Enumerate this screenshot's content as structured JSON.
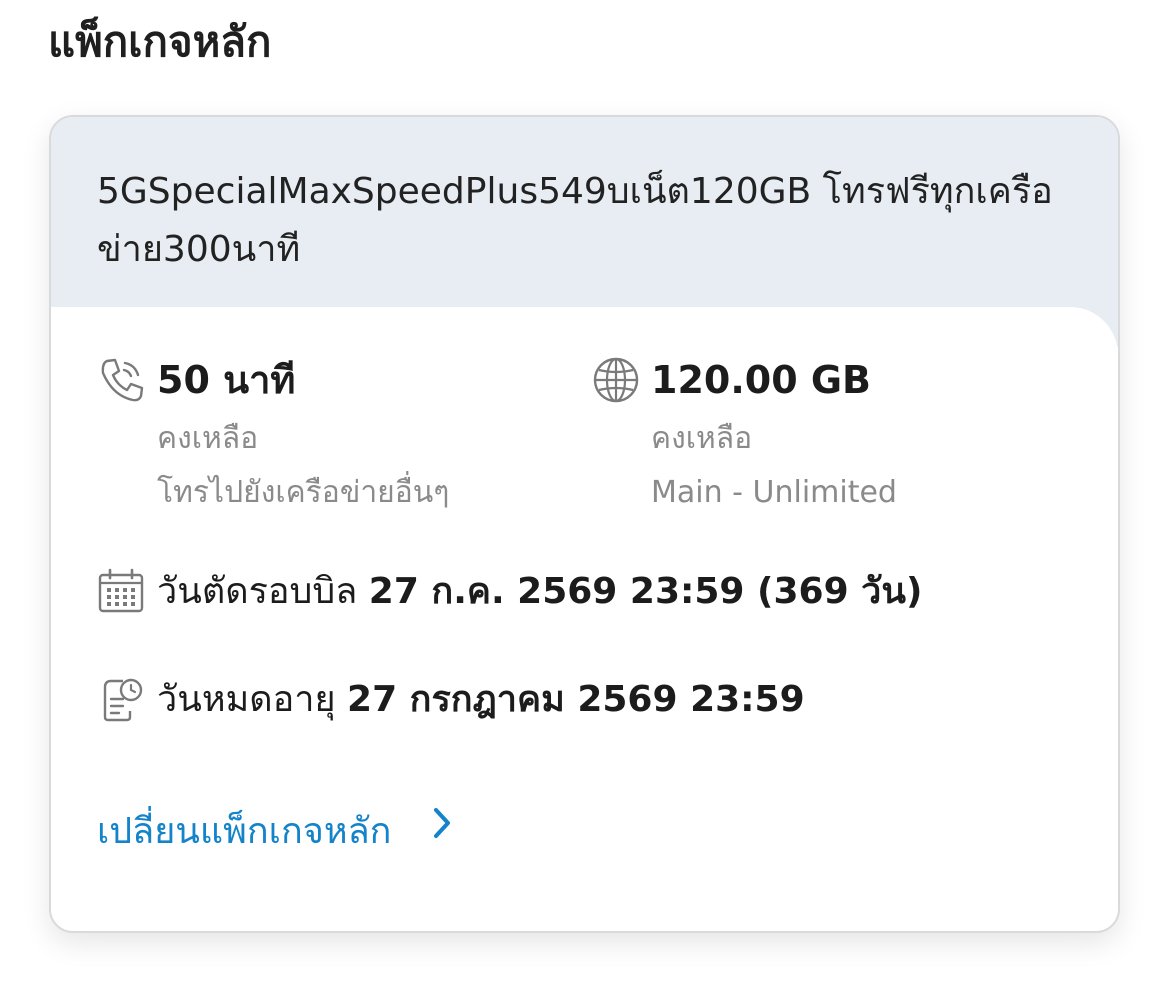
{
  "section": {
    "title": "แพ็กเกจหลัก"
  },
  "package": {
    "name": "5GSpecialMaxSpeedPlus549บเน็ต120GB โทรฟรีทุกเครือข่าย300นาที",
    "voice": {
      "amount": "50 นาที",
      "status": "คงเหลือ",
      "note": "โทรไปยังเครือข่ายอื่นๆ",
      "icon": "phone-icon"
    },
    "data": {
      "amount": "120.00 GB",
      "status": "คงเหลือ",
      "note": "Main - Unlimited",
      "icon": "globe-icon"
    },
    "billing": {
      "label": "วันตัดรอบบิล",
      "value": "27 ก.ค. 2569 23:59 (369 วัน)",
      "icon": "calendar-icon"
    },
    "expiry": {
      "label": "วันหมดอายุ",
      "value": "27 กรกฎาคม 2569 23:59",
      "icon": "document-clock-icon"
    },
    "change_link": {
      "label": "เปลี่ยนแพ็กเกจหลัก",
      "icon": "chevron-right-icon"
    }
  },
  "colors": {
    "header_bg": "#e7edf3",
    "link": "#1483c9",
    "muted_text": "#8a8a8a"
  }
}
